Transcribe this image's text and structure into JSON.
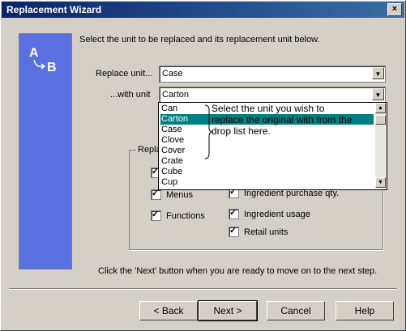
{
  "window": {
    "title": "Replacement Wizard",
    "close_label": "×"
  },
  "intro_text": "Select the unit to be replaced and its replacement unit below.",
  "replace": {
    "label": "Replace unit...",
    "value": "Case"
  },
  "with": {
    "label": "...with unit",
    "value": "Carton"
  },
  "dropdown": {
    "items": [
      "Can",
      "Carton",
      "Case",
      "Clove",
      "Cover",
      "Crate",
      "Cube",
      "Cup"
    ],
    "selected": 1
  },
  "callout_text": "Select the unit you wish to replace the original with from the drop list here.",
  "group": {
    "legend": "Repla"
  },
  "checkboxes": {
    "menus": "Menus",
    "functions": "Functions",
    "ingredient_purchase": "Ingredient purchase qty.",
    "ingredient_usage": "Ingredient usage",
    "retail_units": "Retail units"
  },
  "footer_text": "Click the 'Next' button when you are ready to move on to the next step.",
  "buttons": {
    "back": "< Back",
    "next": "Next >",
    "cancel": "Cancel",
    "help": "Help"
  },
  "icon_letters": {
    "a": "A",
    "b": "B"
  }
}
